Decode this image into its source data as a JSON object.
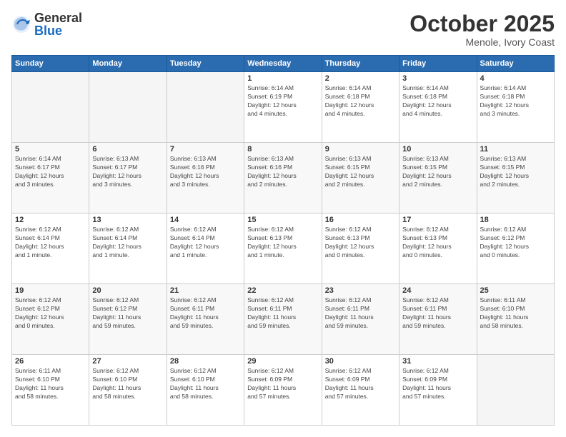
{
  "logo": {
    "general": "General",
    "blue": "Blue"
  },
  "header": {
    "month": "October 2025",
    "location": "Menole, Ivory Coast"
  },
  "weekdays": [
    "Sunday",
    "Monday",
    "Tuesday",
    "Wednesday",
    "Thursday",
    "Friday",
    "Saturday"
  ],
  "weeks": [
    [
      {
        "day": "",
        "info": "",
        "empty": true
      },
      {
        "day": "",
        "info": "",
        "empty": true
      },
      {
        "day": "",
        "info": "",
        "empty": true
      },
      {
        "day": "1",
        "info": "Sunrise: 6:14 AM\nSunset: 6:19 PM\nDaylight: 12 hours\nand 4 minutes.",
        "empty": false
      },
      {
        "day": "2",
        "info": "Sunrise: 6:14 AM\nSunset: 6:18 PM\nDaylight: 12 hours\nand 4 minutes.",
        "empty": false
      },
      {
        "day": "3",
        "info": "Sunrise: 6:14 AM\nSunset: 6:18 PM\nDaylight: 12 hours\nand 4 minutes.",
        "empty": false
      },
      {
        "day": "4",
        "info": "Sunrise: 6:14 AM\nSunset: 6:18 PM\nDaylight: 12 hours\nand 3 minutes.",
        "empty": false
      }
    ],
    [
      {
        "day": "5",
        "info": "Sunrise: 6:14 AM\nSunset: 6:17 PM\nDaylight: 12 hours\nand 3 minutes.",
        "empty": false
      },
      {
        "day": "6",
        "info": "Sunrise: 6:13 AM\nSunset: 6:17 PM\nDaylight: 12 hours\nand 3 minutes.",
        "empty": false
      },
      {
        "day": "7",
        "info": "Sunrise: 6:13 AM\nSunset: 6:16 PM\nDaylight: 12 hours\nand 3 minutes.",
        "empty": false
      },
      {
        "day": "8",
        "info": "Sunrise: 6:13 AM\nSunset: 6:16 PM\nDaylight: 12 hours\nand 2 minutes.",
        "empty": false
      },
      {
        "day": "9",
        "info": "Sunrise: 6:13 AM\nSunset: 6:15 PM\nDaylight: 12 hours\nand 2 minutes.",
        "empty": false
      },
      {
        "day": "10",
        "info": "Sunrise: 6:13 AM\nSunset: 6:15 PM\nDaylight: 12 hours\nand 2 minutes.",
        "empty": false
      },
      {
        "day": "11",
        "info": "Sunrise: 6:13 AM\nSunset: 6:15 PM\nDaylight: 12 hours\nand 2 minutes.",
        "empty": false
      }
    ],
    [
      {
        "day": "12",
        "info": "Sunrise: 6:12 AM\nSunset: 6:14 PM\nDaylight: 12 hours\nand 1 minute.",
        "empty": false
      },
      {
        "day": "13",
        "info": "Sunrise: 6:12 AM\nSunset: 6:14 PM\nDaylight: 12 hours\nand 1 minute.",
        "empty": false
      },
      {
        "day": "14",
        "info": "Sunrise: 6:12 AM\nSunset: 6:14 PM\nDaylight: 12 hours\nand 1 minute.",
        "empty": false
      },
      {
        "day": "15",
        "info": "Sunrise: 6:12 AM\nSunset: 6:13 PM\nDaylight: 12 hours\nand 1 minute.",
        "empty": false
      },
      {
        "day": "16",
        "info": "Sunrise: 6:12 AM\nSunset: 6:13 PM\nDaylight: 12 hours\nand 0 minutes.",
        "empty": false
      },
      {
        "day": "17",
        "info": "Sunrise: 6:12 AM\nSunset: 6:13 PM\nDaylight: 12 hours\nand 0 minutes.",
        "empty": false
      },
      {
        "day": "18",
        "info": "Sunrise: 6:12 AM\nSunset: 6:12 PM\nDaylight: 12 hours\nand 0 minutes.",
        "empty": false
      }
    ],
    [
      {
        "day": "19",
        "info": "Sunrise: 6:12 AM\nSunset: 6:12 PM\nDaylight: 12 hours\nand 0 minutes.",
        "empty": false
      },
      {
        "day": "20",
        "info": "Sunrise: 6:12 AM\nSunset: 6:12 PM\nDaylight: 11 hours\nand 59 minutes.",
        "empty": false
      },
      {
        "day": "21",
        "info": "Sunrise: 6:12 AM\nSunset: 6:11 PM\nDaylight: 11 hours\nand 59 minutes.",
        "empty": false
      },
      {
        "day": "22",
        "info": "Sunrise: 6:12 AM\nSunset: 6:11 PM\nDaylight: 11 hours\nand 59 minutes.",
        "empty": false
      },
      {
        "day": "23",
        "info": "Sunrise: 6:12 AM\nSunset: 6:11 PM\nDaylight: 11 hours\nand 59 minutes.",
        "empty": false
      },
      {
        "day": "24",
        "info": "Sunrise: 6:12 AM\nSunset: 6:11 PM\nDaylight: 11 hours\nand 59 minutes.",
        "empty": false
      },
      {
        "day": "25",
        "info": "Sunrise: 6:11 AM\nSunset: 6:10 PM\nDaylight: 11 hours\nand 58 minutes.",
        "empty": false
      }
    ],
    [
      {
        "day": "26",
        "info": "Sunrise: 6:11 AM\nSunset: 6:10 PM\nDaylight: 11 hours\nand 58 minutes.",
        "empty": false
      },
      {
        "day": "27",
        "info": "Sunrise: 6:12 AM\nSunset: 6:10 PM\nDaylight: 11 hours\nand 58 minutes.",
        "empty": false
      },
      {
        "day": "28",
        "info": "Sunrise: 6:12 AM\nSunset: 6:10 PM\nDaylight: 11 hours\nand 58 minutes.",
        "empty": false
      },
      {
        "day": "29",
        "info": "Sunrise: 6:12 AM\nSunset: 6:09 PM\nDaylight: 11 hours\nand 57 minutes.",
        "empty": false
      },
      {
        "day": "30",
        "info": "Sunrise: 6:12 AM\nSunset: 6:09 PM\nDaylight: 11 hours\nand 57 minutes.",
        "empty": false
      },
      {
        "day": "31",
        "info": "Sunrise: 6:12 AM\nSunset: 6:09 PM\nDaylight: 11 hours\nand 57 minutes.",
        "empty": false
      },
      {
        "day": "",
        "info": "",
        "empty": true
      }
    ]
  ]
}
